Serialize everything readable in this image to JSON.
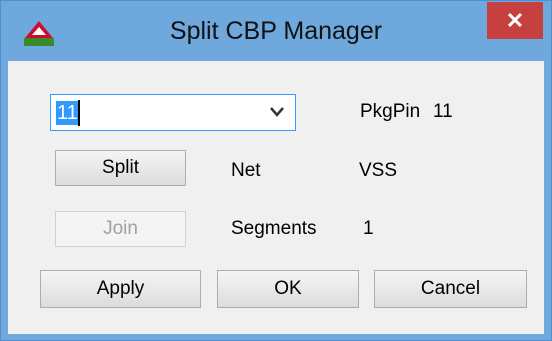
{
  "window": {
    "title": "Split CBP Manager",
    "close_glyph": "✕",
    "app_icon": "red-triangle-app-icon",
    "accent_color": "#6fa8dc",
    "close_color": "#c74040"
  },
  "combo": {
    "value": "11",
    "options_visible": [
      "11"
    ],
    "arrow_icon": "chevron-down-icon"
  },
  "info": {
    "pkgpin_label": "PkgPin",
    "pkgpin_value": "11",
    "net_label": "Net",
    "net_value": "VSS",
    "segments_label": "Segments",
    "segments_value": "1"
  },
  "buttons": {
    "split": "Split",
    "join": "Join",
    "apply": "Apply",
    "ok": "OK",
    "cancel": "Cancel"
  }
}
